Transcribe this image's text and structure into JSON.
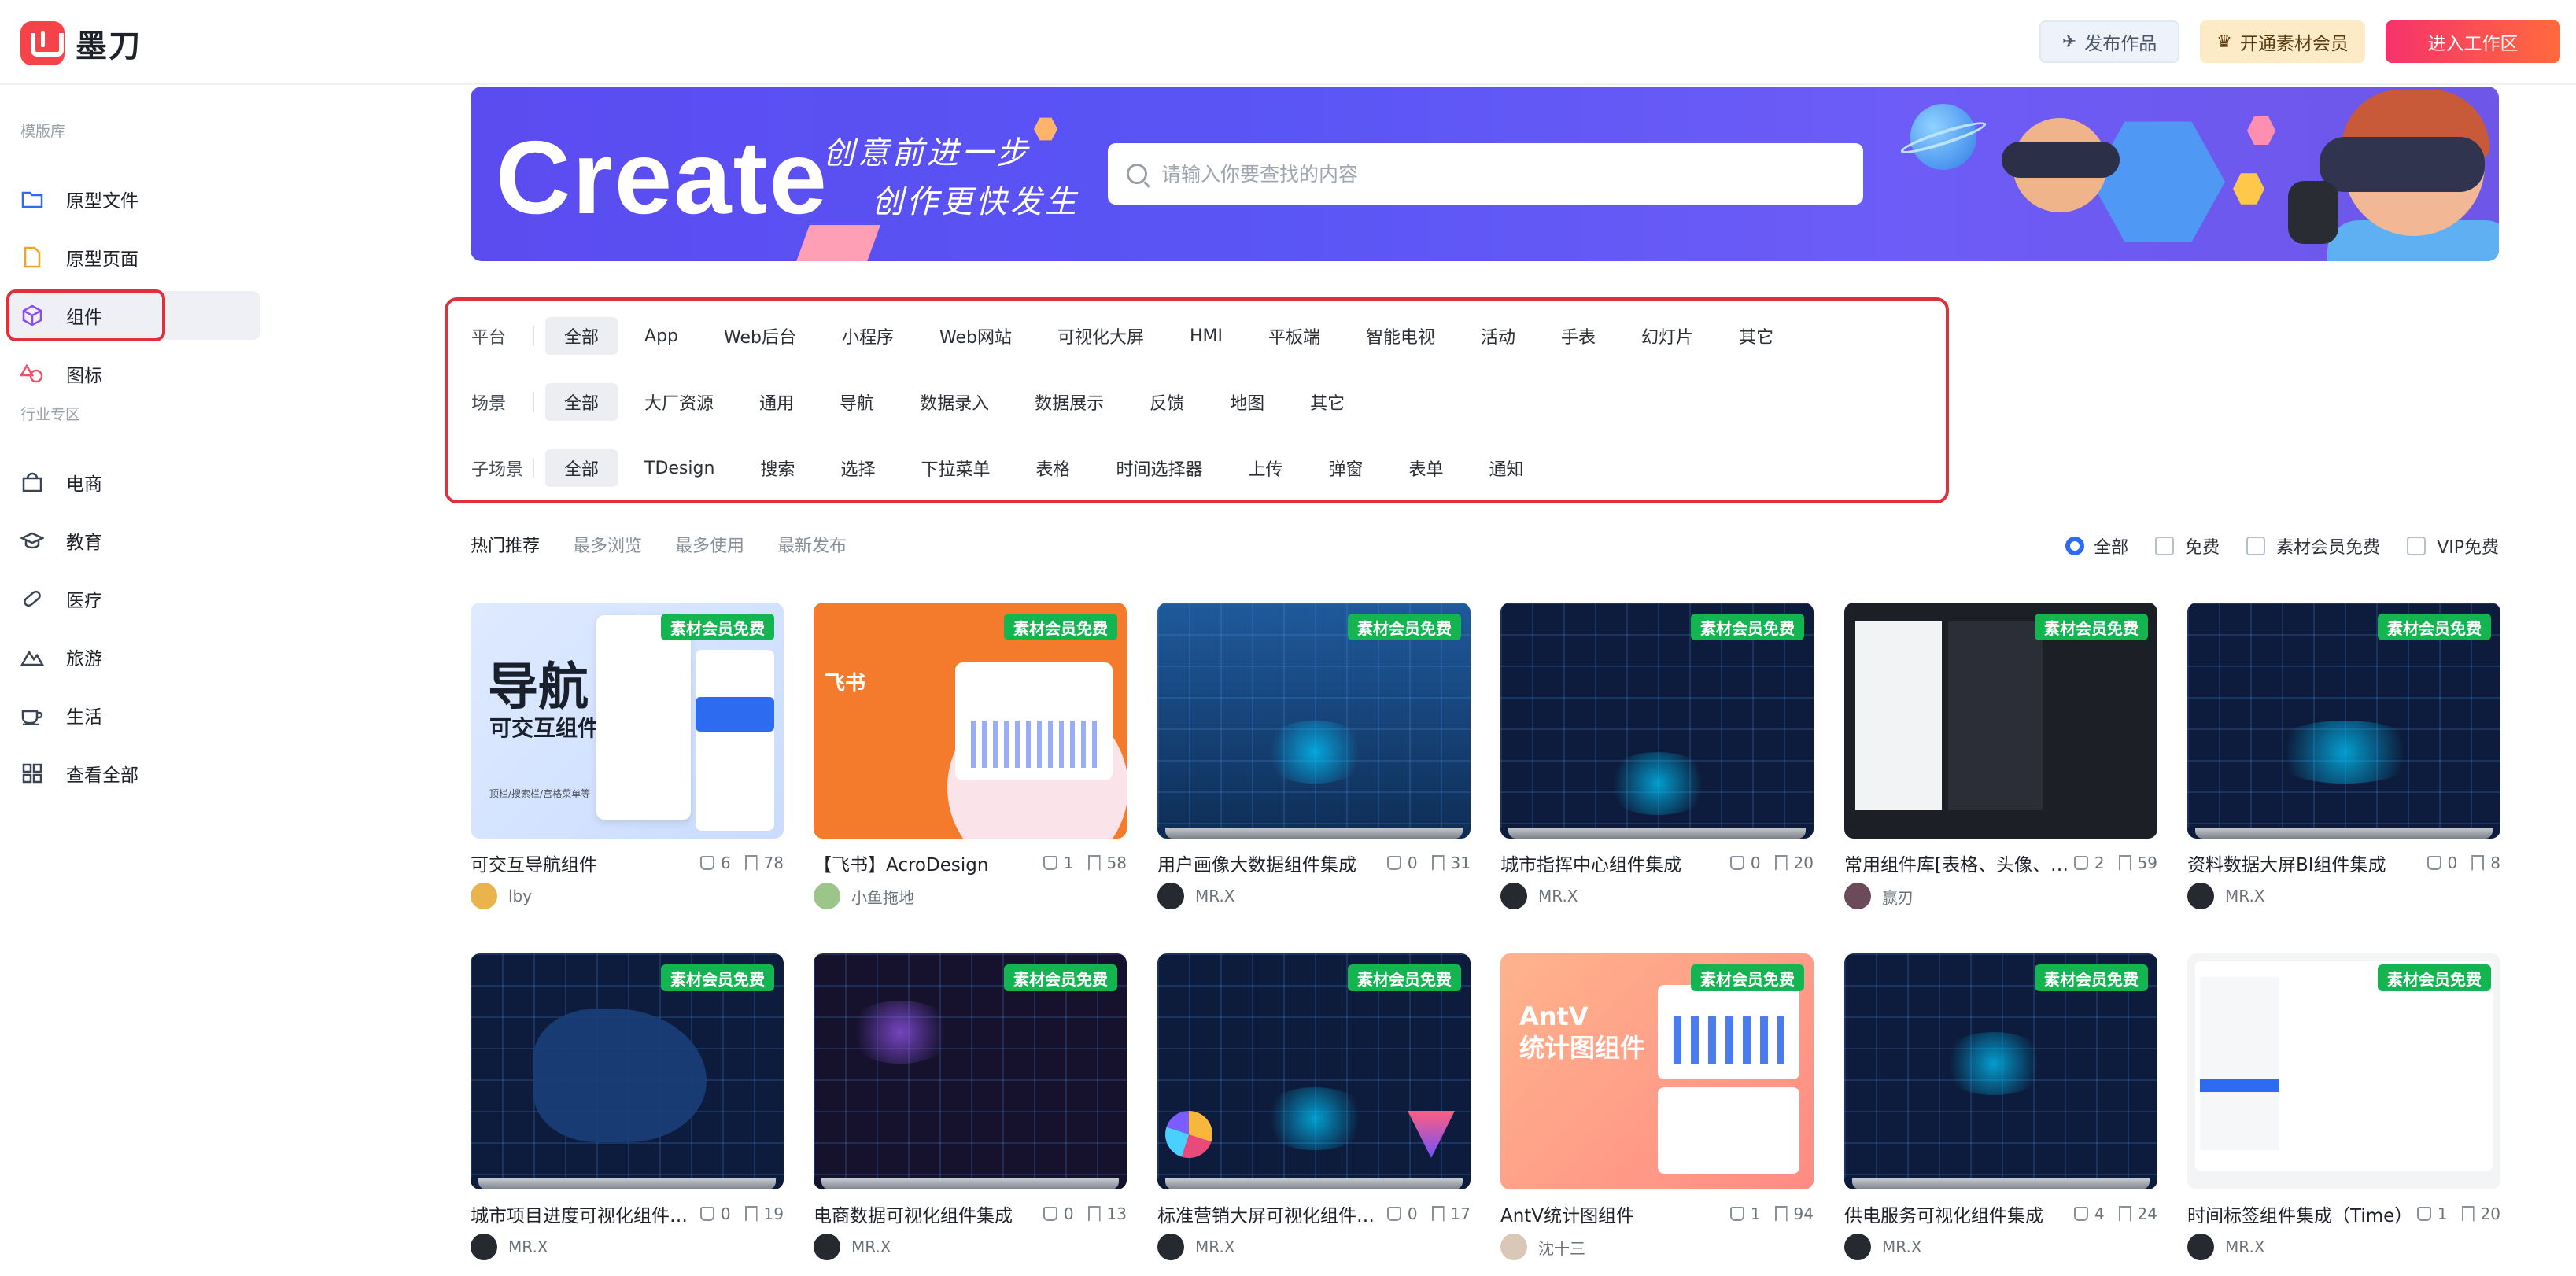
{
  "header": {
    "logo_text": "墨刀",
    "publish_label": "发布作品",
    "vip_label": "开通素材会员",
    "enter_label": "进入工作区"
  },
  "sidebar": {
    "group1": "模版库",
    "group2": "行业专区",
    "items": [
      {
        "label": "原型文件",
        "icon": "folder-icon"
      },
      {
        "label": "原型页面",
        "icon": "page-icon"
      },
      {
        "label": "组件",
        "icon": "cube-icon",
        "active": true
      },
      {
        "label": "图标",
        "icon": "shapes-icon"
      }
    ],
    "industry": [
      {
        "label": "电商",
        "icon": "shop-icon"
      },
      {
        "label": "教育",
        "icon": "graduation-icon"
      },
      {
        "label": "医疗",
        "icon": "pill-icon"
      },
      {
        "label": "旅游",
        "icon": "mountain-icon"
      },
      {
        "label": "生活",
        "icon": "coffee-icon"
      },
      {
        "label": "查看全部",
        "icon": "grid-icon"
      }
    ]
  },
  "banner": {
    "title": "Create",
    "slogan1": "创意前进一步",
    "slogan2": "创作更快发生",
    "search_placeholder": "请输入你要查找的内容"
  },
  "filters": {
    "platform": {
      "label": "平台",
      "options": [
        "全部",
        "App",
        "Web后台",
        "小程序",
        "Web网站",
        "可视化大屏",
        "HMI",
        "平板端",
        "智能电视",
        "活动",
        "手表",
        "幻灯片",
        "其它"
      ]
    },
    "scene": {
      "label": "场景",
      "options": [
        "全部",
        "大厂资源",
        "通用",
        "导航",
        "数据录入",
        "数据展示",
        "反馈",
        "地图",
        "其它"
      ]
    },
    "subscene": {
      "label": "子场景",
      "options": [
        "全部",
        "TDesign",
        "搜索",
        "选择",
        "下拉菜单",
        "表格",
        "时间选择器",
        "上传",
        "弹窗",
        "表单",
        "通知"
      ]
    }
  },
  "sort": {
    "tabs": [
      "热门推荐",
      "最多浏览",
      "最多使用",
      "最新发布"
    ],
    "options": [
      "全部",
      "免费",
      "素材会员免费",
      "VIP免费"
    ]
  },
  "badge": "素材会员免费",
  "cards": [
    {
      "title": "可交互导航组件",
      "likes": "6",
      "favs": "78",
      "author": "lby",
      "thumb_title": "导航",
      "thumb_sub": "可交互组件",
      "thumb_note": "顶栏/搜索栏/宫格菜单等"
    },
    {
      "title": "【飞书】AcroDesign",
      "likes": "1",
      "favs": "58",
      "author": "小鱼拖地",
      "thumb_title": "飞书"
    },
    {
      "title": "用户画像大数据组件集成",
      "likes": "0",
      "favs": "31",
      "author": "MR.X"
    },
    {
      "title": "城市指挥中心组件集成",
      "likes": "0",
      "favs": "20",
      "author": "MR.X"
    },
    {
      "title": "常用组件库[表格、头像、…",
      "likes": "2",
      "favs": "59",
      "author": "赢刃"
    },
    {
      "title": "资料数据大屏BI组件集成",
      "likes": "0",
      "favs": "8",
      "author": "MR.X"
    },
    {
      "title": "城市项目进度可视化组件…",
      "likes": "0",
      "favs": "19",
      "author": "MR.X"
    },
    {
      "title": "电商数据可视化组件集成",
      "likes": "0",
      "favs": "13",
      "author": "MR.X"
    },
    {
      "title": "标准营销大屏可视化组件…",
      "likes": "0",
      "favs": "17",
      "author": "MR.X"
    },
    {
      "title": "AntV统计图组件",
      "likes": "1",
      "favs": "94",
      "author": "沈十三",
      "thumb_title": "AntV\n统计图组件"
    },
    {
      "title": "供电服务可视化组件集成",
      "likes": "4",
      "favs": "24",
      "author": "MR.X"
    },
    {
      "title": "时间标签组件集成（Time）",
      "likes": "1",
      "favs": "20",
      "author": "MR.X"
    }
  ]
}
